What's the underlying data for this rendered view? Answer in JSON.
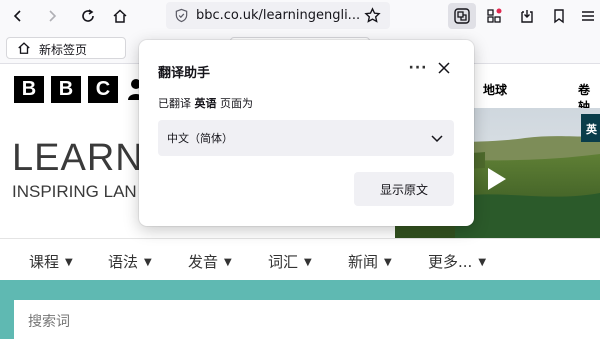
{
  "browser": {
    "url": "bbc.co.uk/learningengli...",
    "tab_label": "新标签页"
  },
  "popup": {
    "title": "翻译助手",
    "more_label": "···",
    "desc_prefix": "已翻译",
    "desc_lang": "英语",
    "desc_suffix": "页面为",
    "selected_language": "中文（简体）",
    "show_original_label": "显示原文"
  },
  "site": {
    "bbc_letters": [
      "B",
      "B",
      "C"
    ],
    "title": "LEARN",
    "subtitle": "INSPIRING LAN",
    "top_links": [
      "地球",
      "卷轴"
    ],
    "hero_badge": "英",
    "nav": [
      "课程",
      "语法",
      "发音",
      "词汇",
      "新闻",
      "更多..."
    ],
    "search_placeholder": "搜索词"
  },
  "colors": {
    "teal": "#5fb9b2",
    "notification_dot": "#e22850"
  }
}
